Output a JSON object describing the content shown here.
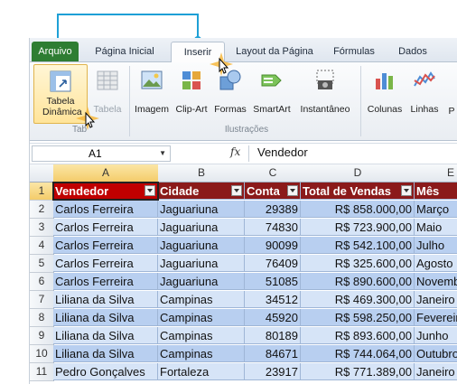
{
  "ribbon_tabs": [
    "Arquivo",
    "Página Inicial",
    "Inserir",
    "Layout da Página",
    "Fórmulas",
    "Dados"
  ],
  "ribbon_buttons": {
    "pivot": "Tabela Dinâmica",
    "table": "Tabela",
    "image": "Imagem",
    "clipart": "Clip-Art",
    "shapes": "Formas",
    "smartart": "SmartArt",
    "snapshot": "Instantâneo",
    "columns": "Colunas",
    "lines": "Linhas",
    "more": "P"
  },
  "groups": {
    "tables": "Tab",
    "illustrations": "Ilustrações"
  },
  "formula_bar": {
    "name_box": "A1",
    "fx": "fx",
    "value": "Vendedor"
  },
  "columns": [
    "A",
    "B",
    "C",
    "D",
    "E"
  ],
  "headers": [
    "Vendedor",
    "Cidade",
    "Conta",
    "Total de Vendas",
    "Mês"
  ],
  "rows": [
    {
      "n": "2",
      "cells": [
        "Carlos Ferreira",
        "Jaguariuna",
        "29389",
        "R$ 858.000,00",
        "Março"
      ]
    },
    {
      "n": "3",
      "cells": [
        "Carlos Ferreira",
        "Jaguariuna",
        "74830",
        "R$ 723.900,00",
        "Maio"
      ]
    },
    {
      "n": "4",
      "cells": [
        "Carlos Ferreira",
        "Jaguariuna",
        "90099",
        "R$ 542.100,00",
        "Julho"
      ]
    },
    {
      "n": "5",
      "cells": [
        "Carlos Ferreira",
        "Jaguariuna",
        "76409",
        "R$ 325.600,00",
        "Agosto"
      ]
    },
    {
      "n": "6",
      "cells": [
        "Carlos Ferreira",
        "Jaguariuna",
        "51085",
        "R$ 890.600,00",
        "Novembro"
      ]
    },
    {
      "n": "7",
      "cells": [
        "Liliana da Silva",
        "Campinas",
        "34512",
        "R$ 469.300,00",
        "Janeiro"
      ]
    },
    {
      "n": "8",
      "cells": [
        "Liliana da Silva",
        "Campinas",
        "45920",
        "R$ 598.250,00",
        "Fevereiro"
      ]
    },
    {
      "n": "9",
      "cells": [
        "Liliana da Silva",
        "Campinas",
        "80189",
        "R$ 893.600,00",
        "Junho"
      ]
    },
    {
      "n": "10",
      "cells": [
        "Liliana da Silva",
        "Campinas",
        "84671",
        "R$ 744.064,00",
        "Outubro"
      ]
    },
    {
      "n": "11",
      "cells": [
        "Pedro Gonçalves",
        "Fortaleza",
        "23917",
        "R$ 771.389,00",
        "Janeiro"
      ]
    }
  ],
  "header_row_number": "1",
  "colors": {
    "accent": "#1ea0d6",
    "header_first": "#c00000",
    "header": "#8b1a1a",
    "row_even": "#b8cff0",
    "row_odd": "#d6e4f7",
    "file_tab": "#2e7d32"
  }
}
